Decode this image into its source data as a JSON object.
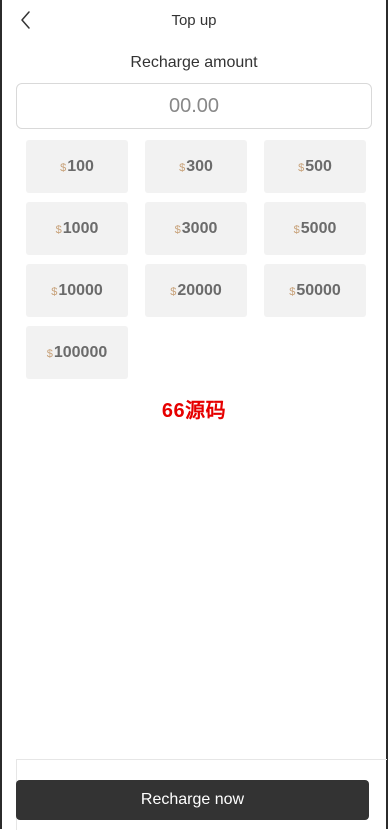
{
  "header": {
    "title": "Top up",
    "back_icon": "chevron-left-icon"
  },
  "recharge": {
    "label": "Recharge amount",
    "input_placeholder": "00.00",
    "input_value": "",
    "currency_symbol": "$",
    "options": [
      "100",
      "300",
      "500",
      "1000",
      "3000",
      "5000",
      "10000",
      "20000",
      "50000",
      "100000"
    ]
  },
  "watermark": {
    "text": "66源码",
    "color": "#e60000"
  },
  "footer": {
    "button_label": "Recharge now"
  },
  "colors": {
    "button_bg": "#333333",
    "option_bg": "#f2f2f2",
    "currency": "#c8a27a"
  }
}
